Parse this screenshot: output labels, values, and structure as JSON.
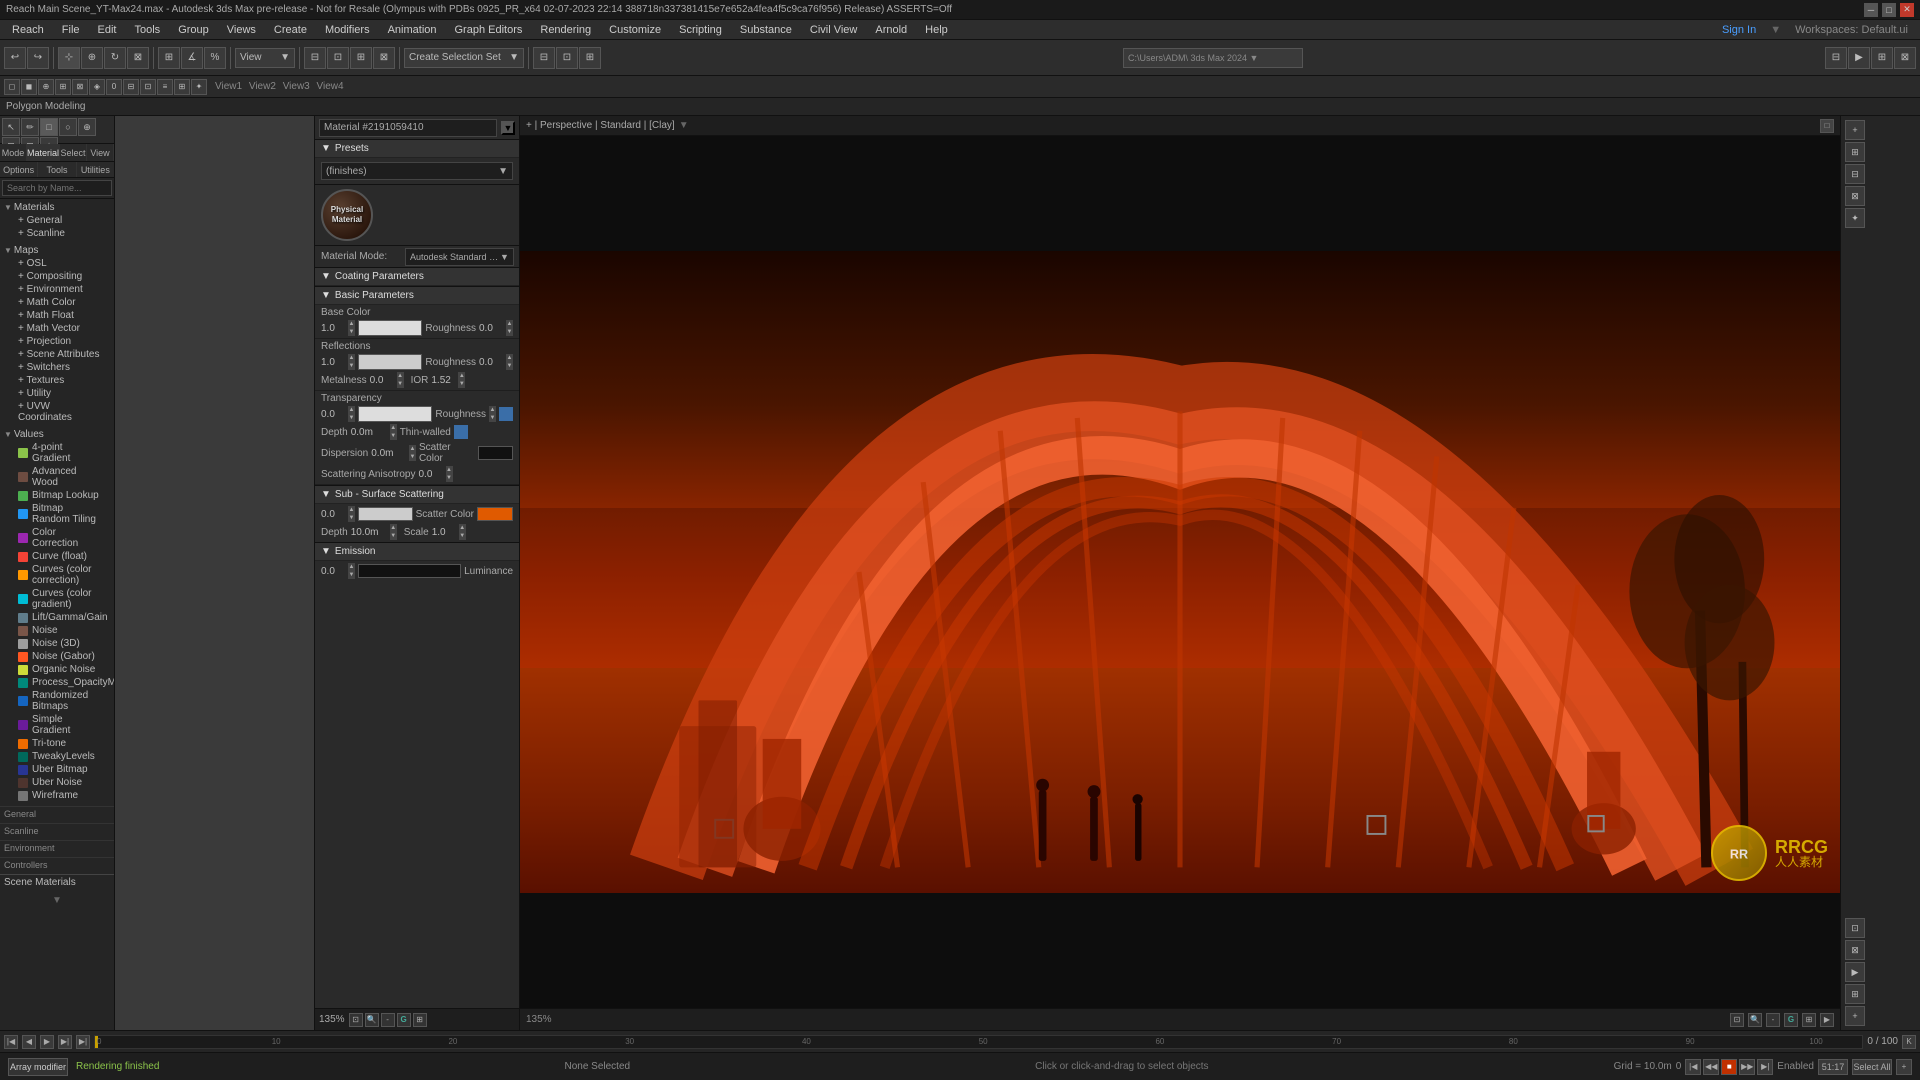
{
  "titleBar": {
    "title": "Reach Main Scene_YT-Max24.max - Autodesk 3ds Max pre-release - Not for Resale (Olympus with PDBs 0925_PR_x64 02-07-2023 22:14 388718n337381415e7e652a4fea4f5c9ca76f956) Release) ASSERTS=Off",
    "winBtns": [
      "─",
      "□",
      "✕"
    ]
  },
  "menuBar": {
    "items": [
      "Reach",
      "File",
      "Edit",
      "Tools",
      "Group",
      "Views",
      "Create",
      "Modifiers",
      "Animation",
      "Graph Editors",
      "Rendering",
      "Customize",
      "Scripting",
      "Substance",
      "Civil View",
      "Arnold",
      "Help"
    ]
  },
  "polyBar": {
    "label": "Polygon Modeling"
  },
  "leftPanel": {
    "searchPlaceholder": "Search by Name...",
    "tabs": [
      "Mode",
      "Material",
      "Select",
      "View",
      "Options",
      "Tools",
      "Utilities"
    ],
    "sections": [
      {
        "label": "Materials",
        "subsections": [
          {
            "label": "+ General"
          },
          {
            "label": "+ Scanline"
          }
        ]
      },
      {
        "label": "Maps",
        "subsections": [
          {
            "label": "+ OSL"
          },
          {
            "label": "+ Compositing"
          },
          {
            "label": "+ Environment"
          },
          {
            "label": "+ Math Color"
          },
          {
            "label": "+ Math Float"
          },
          {
            "label": "+ Math Vector"
          },
          {
            "label": "+ Projection"
          },
          {
            "label": "+ Scene Attributes"
          },
          {
            "label": "+ Switchers"
          },
          {
            "label": "+ Textures"
          },
          {
            "label": "+ Utility"
          },
          {
            "label": "+ UVW Coordinates"
          }
        ]
      },
      {
        "label": "Values",
        "items": [
          {
            "label": "4-point Gradient",
            "color": "#8bc34a"
          },
          {
            "label": "Advanced Wood",
            "color": "#6d4c41"
          },
          {
            "label": "Bitmap Lookup",
            "color": "#4caf50"
          },
          {
            "label": "Bitmap Random Tiling",
            "color": "#2196f3"
          },
          {
            "label": "Color Correction",
            "color": "#9c27b0"
          },
          {
            "label": "Curve (float)",
            "color": "#f44336"
          },
          {
            "label": "Curves (color correction)",
            "color": "#ff9800"
          },
          {
            "label": "Curves (color gradient)",
            "color": "#00bcd4"
          },
          {
            "label": "Lift/Gamma/Gain",
            "color": "#607d8b"
          },
          {
            "label": "Noise",
            "color": "#795548"
          },
          {
            "label": "Noise (3D)",
            "color": "#9e9e9e"
          },
          {
            "label": "Noise (Gabor)",
            "color": "#ff5722"
          },
          {
            "label": "Organic Noise",
            "color": "#cddc39"
          },
          {
            "label": "Process_OpacityMap",
            "color": "#00897b"
          },
          {
            "label": "Randomized Bitmaps",
            "color": "#1565c0"
          },
          {
            "label": "Simple Gradient",
            "color": "#6a1b9a"
          },
          {
            "label": "Tri-tone",
            "color": "#ef6c00"
          },
          {
            "label": "TweakyLevels",
            "color": "#00695c"
          },
          {
            "label": "Uber Bitmap",
            "color": "#283593"
          },
          {
            "label": "Uber Noise",
            "color": "#4e342e"
          },
          {
            "label": "Wireframe",
            "color": "#757575"
          }
        ]
      },
      {
        "label": "General"
      },
      {
        "label": "Scanline"
      },
      {
        "label": "Environment"
      },
      {
        "label": "Controllers"
      },
      {
        "label": "Scene Materials"
      }
    ]
  },
  "materialEditor": {
    "materialId": "Material #2191059410",
    "presetsLabel": "Presets",
    "presetsDropdown": "(finishes)",
    "sphereLabel": "Physical\nMaterial",
    "modeLabel": "Material Mode:",
    "modeValue": "Autodesk Standard Surface Compliant",
    "sections": [
      {
        "label": "Coating Parameters",
        "rows": []
      },
      {
        "label": "Basic Parameters",
        "subsections": [
          {
            "label": "Base Color",
            "fields": [
              {
                "name": "value",
                "val": "1.0"
              },
              {
                "name": "roughness",
                "val": "Roughness",
                "rval": "0.0"
              }
            ]
          },
          {
            "label": "Reflections",
            "fields": [
              {
                "name": "value",
                "val": "1.0"
              },
              {
                "name": "roughness",
                "val": "Roughness",
                "rval": "0.0"
              },
              {
                "name": "metalness",
                "val": "Metalness",
                "mval": "0.0"
              },
              {
                "name": "ior",
                "val": "IOR",
                "iorval": "1.52"
              }
            ]
          },
          {
            "label": "Transparency",
            "fields": [
              {
                "name": "value",
                "val": "0.0"
              },
              {
                "name": "depth",
                "val": "Depth",
                "dval": "0.0m"
              },
              {
                "name": "thin",
                "val": "Thin-walled"
              },
              {
                "name": "dispersion",
                "val": "Dispersion",
                "disval": "0.0m"
              },
              {
                "name": "scatter",
                "val": "Scatter Color"
              },
              {
                "name": "scatterAniso",
                "val": "Scattering Anisotropy",
                "saval": "0.0"
              }
            ]
          }
        ]
      },
      {
        "label": "Sub - Surface Scattering",
        "fields": [
          {
            "name": "value",
            "val": "0.0"
          },
          {
            "name": "scatterColor",
            "val": "Scatter Color"
          },
          {
            "name": "depth",
            "val": "Depth",
            "dval": "10.0m"
          },
          {
            "name": "scale",
            "val": "Scale",
            "sval": "1.0"
          }
        ]
      },
      {
        "label": "Emission",
        "fields": []
      }
    ]
  },
  "viewport": {
    "label": "+ | Perspective | Standard | [Clay]",
    "zoomLevel": "135%"
  },
  "statusBar": {
    "renderFinished": "Rendering finished",
    "frameInfo": "0 / 100",
    "noneSelected": "None Selected",
    "clickDrag": "Click or click-and-drag to select objects"
  },
  "timeline": {
    "ticks": [
      "0",
      "10",
      "20",
      "30",
      "40",
      "50",
      "60",
      "70",
      "80",
      "90",
      "100"
    ]
  },
  "rrcg": {
    "logoText": "RR",
    "brandText": "RRCG",
    "subText": "人人素材"
  }
}
